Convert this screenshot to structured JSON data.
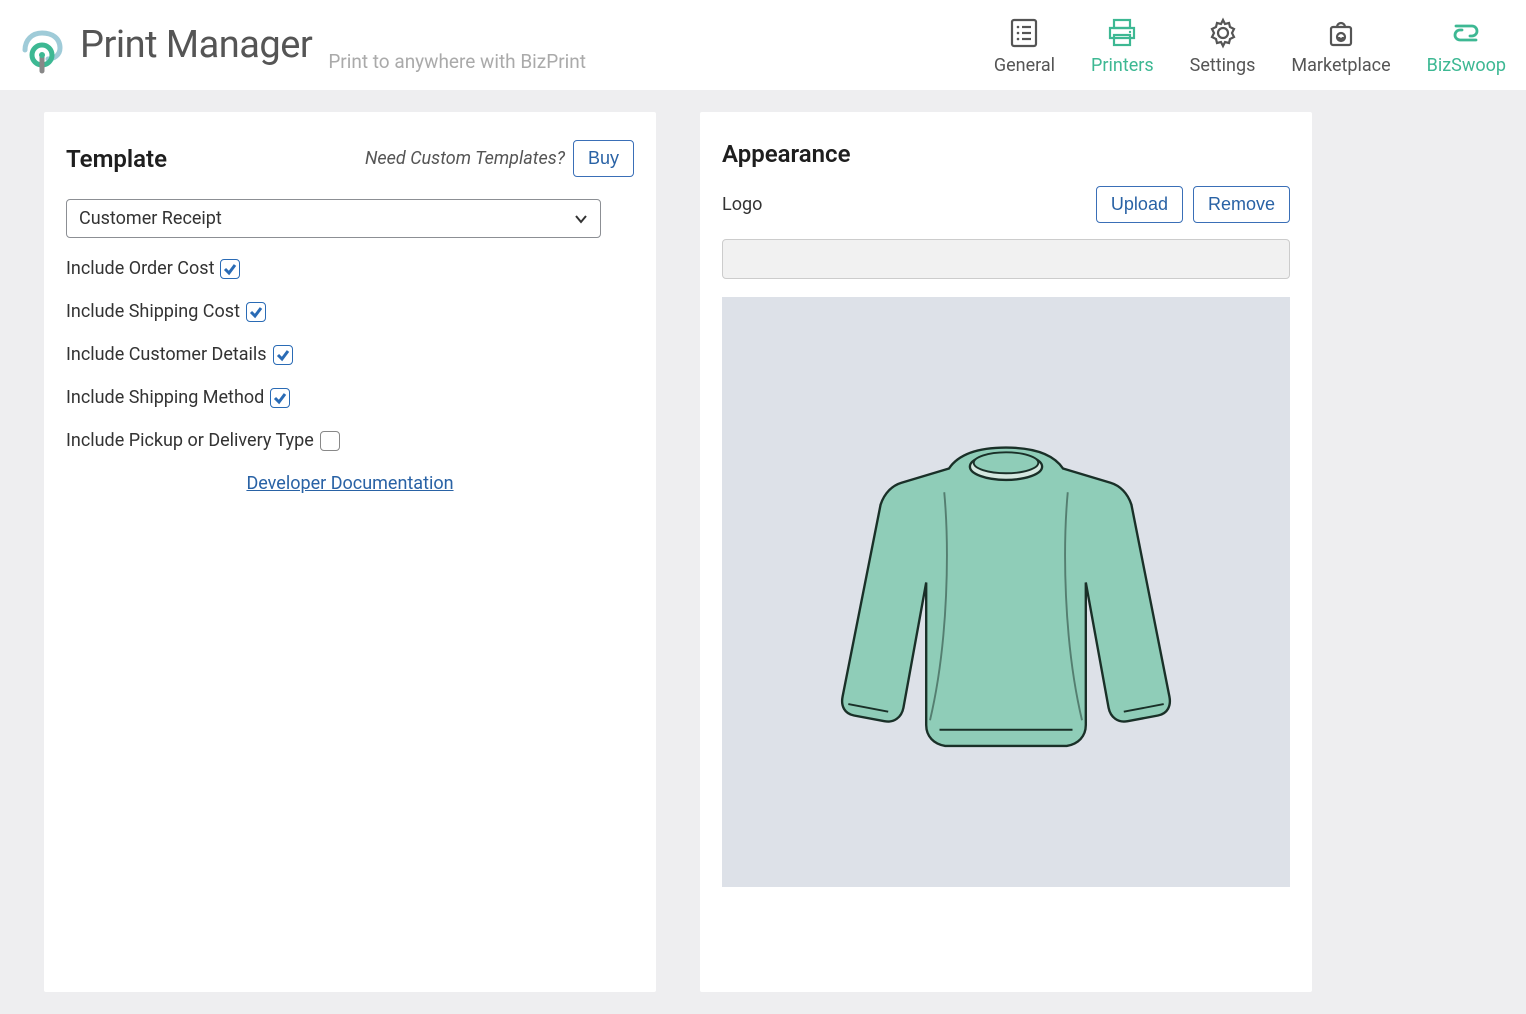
{
  "brand": {
    "title": "Print Manager",
    "tagline": "Print to anywhere with BizPrint"
  },
  "nav": {
    "general": "General",
    "printers": "Printers",
    "settings": "Settings",
    "marketplace": "Marketplace",
    "bizswoop": "BizSwoop"
  },
  "template": {
    "title": "Template",
    "help": "Need Custom Templates?",
    "buy": "Buy",
    "selected": "Customer Receipt",
    "options": {
      "order_cost": "Include Order Cost",
      "shipping_cost": "Include Shipping Cost",
      "customer_details": "Include Customer Details",
      "shipping_method": "Include Shipping Method",
      "pickup_delivery": "Include Pickup or Delivery Type"
    },
    "doc_link": "Developer Documentation"
  },
  "appearance": {
    "title": "Appearance",
    "logo_label": "Logo",
    "upload": "Upload",
    "remove": "Remove"
  },
  "colors": {
    "accent_green": "#3db893",
    "link_blue": "#2962a5"
  }
}
